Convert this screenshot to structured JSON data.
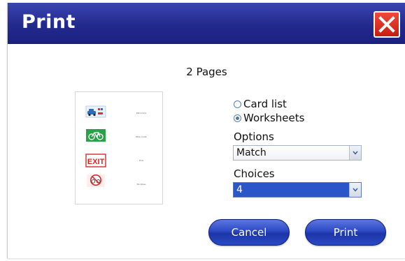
{
  "dialog": {
    "title": "Print",
    "pages_label": "2 Pages"
  },
  "preview": {
    "items": [
      {
        "icon": "car-park-sign-icon",
        "label": "Park here"
      },
      {
        "icon": "bicycle-sign-icon",
        "label": "Bike route"
      },
      {
        "icon": "exit-sign-icon",
        "label": "Exit"
      },
      {
        "icon": "no-bicycles-sign-icon",
        "label": "No bikes"
      }
    ]
  },
  "format": {
    "options": [
      {
        "label": "Card list",
        "checked": false
      },
      {
        "label": "Worksheets",
        "checked": true
      }
    ]
  },
  "options_field": {
    "label": "Options",
    "value": "Match"
  },
  "choices_field": {
    "label": "Choices",
    "value": "4"
  },
  "buttons": {
    "cancel": "Cancel",
    "print": "Print"
  },
  "colors": {
    "titlebar": "#232a8e",
    "close_button": "#d8281c",
    "button_blue": "#2c48c4",
    "selection": "#2b56c7"
  }
}
